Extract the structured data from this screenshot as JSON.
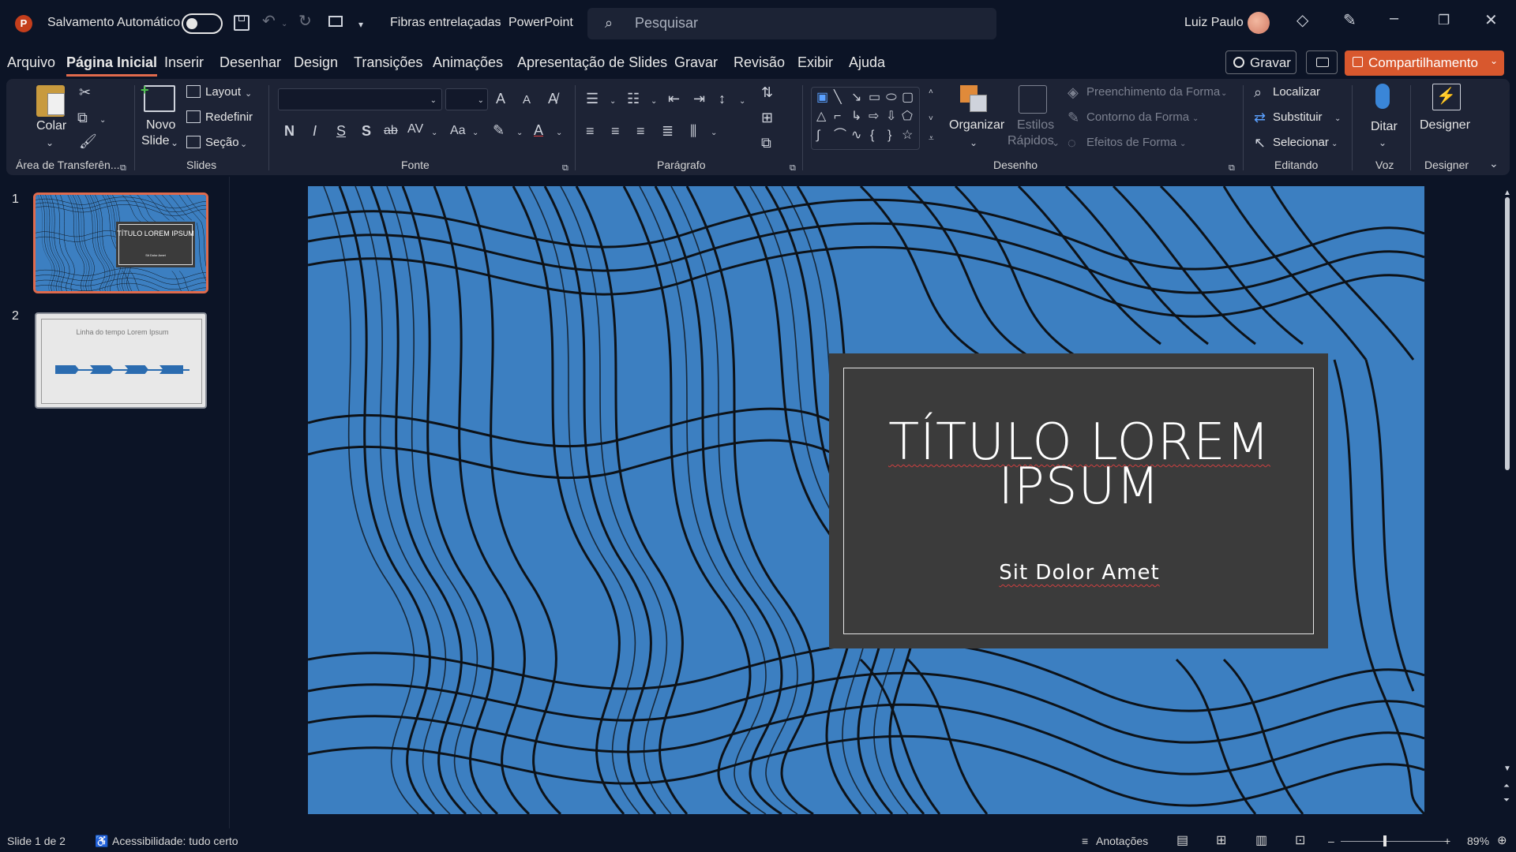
{
  "titlebar": {
    "autosave_label": "Salvamento Automático",
    "doc_title": "Fibras entrelaçadas",
    "separator": "-",
    "app_name": "PowerPoint",
    "search_placeholder": "Pesquisar",
    "user_name": "Luiz Paulo"
  },
  "menu": {
    "tabs": [
      "Arquivo",
      "Página Inicial",
      "Inserir",
      "Desenhar",
      "Design",
      "Transições",
      "Animações",
      "Apresentação de Slides",
      "Gravar",
      "Revisão",
      "Exibir",
      "Ajuda"
    ],
    "active": "Página Inicial",
    "record_label": "Gravar",
    "share_label": "Compartilhamento"
  },
  "ribbon": {
    "clipboard": {
      "paste": "Colar",
      "group": "Área de Transferên..."
    },
    "slides": {
      "new_slide_1": "Novo",
      "new_slide_2": "Slide",
      "layout": "Layout",
      "reset": "Redefinir",
      "section": "Seção",
      "group": "Slides"
    },
    "font": {
      "bold": "N",
      "italic": "I",
      "underline": "S",
      "shadow": "S",
      "strike": "ab",
      "spacing": "AV",
      "case": "Aa",
      "grow": "A",
      "shrink": "A",
      "color": "A",
      "group": "Fonte"
    },
    "paragraph": {
      "group": "Parágrafo"
    },
    "drawing": {
      "arrange": "Organizar",
      "quick_styles_1": "Estilos",
      "quick_styles_2": "Rápidos",
      "fill": "Preenchimento da Forma",
      "outline": "Contorno da Forma",
      "effects": "Efeitos de Forma",
      "group": "Desenho"
    },
    "editing": {
      "find": "Localizar",
      "replace": "Substituir",
      "select": "Selecionar",
      "group": "Editando"
    },
    "voice": {
      "dictate": "Ditar",
      "group": "Voz"
    },
    "designer": {
      "label": "Designer",
      "group": "Designer"
    }
  },
  "thumbnails": [
    {
      "number": "1",
      "title": "TÍTULO LOREM IPSUM",
      "subtitle": "Sit Dolor Amet"
    },
    {
      "number": "2",
      "title": "Linha do tempo Lorem Ipsum"
    }
  ],
  "slide": {
    "title_line1": "TÍTULO LOREM",
    "title_line2": "IPSUM",
    "subtitle": "Sit Dolor Amet",
    "bg_color": "#3c7fc1",
    "card_color": "#3b3b3b"
  },
  "status": {
    "slide_info": "Slide 1 de 2",
    "accessibility": "Acessibilidade: tudo certo",
    "notes": "Anotações",
    "zoom": "89%"
  },
  "colors": {
    "accent": "#e06a4c",
    "share": "#d8582e",
    "ribbon_bg": "#1d2335",
    "window_bg": "#0c1426"
  }
}
